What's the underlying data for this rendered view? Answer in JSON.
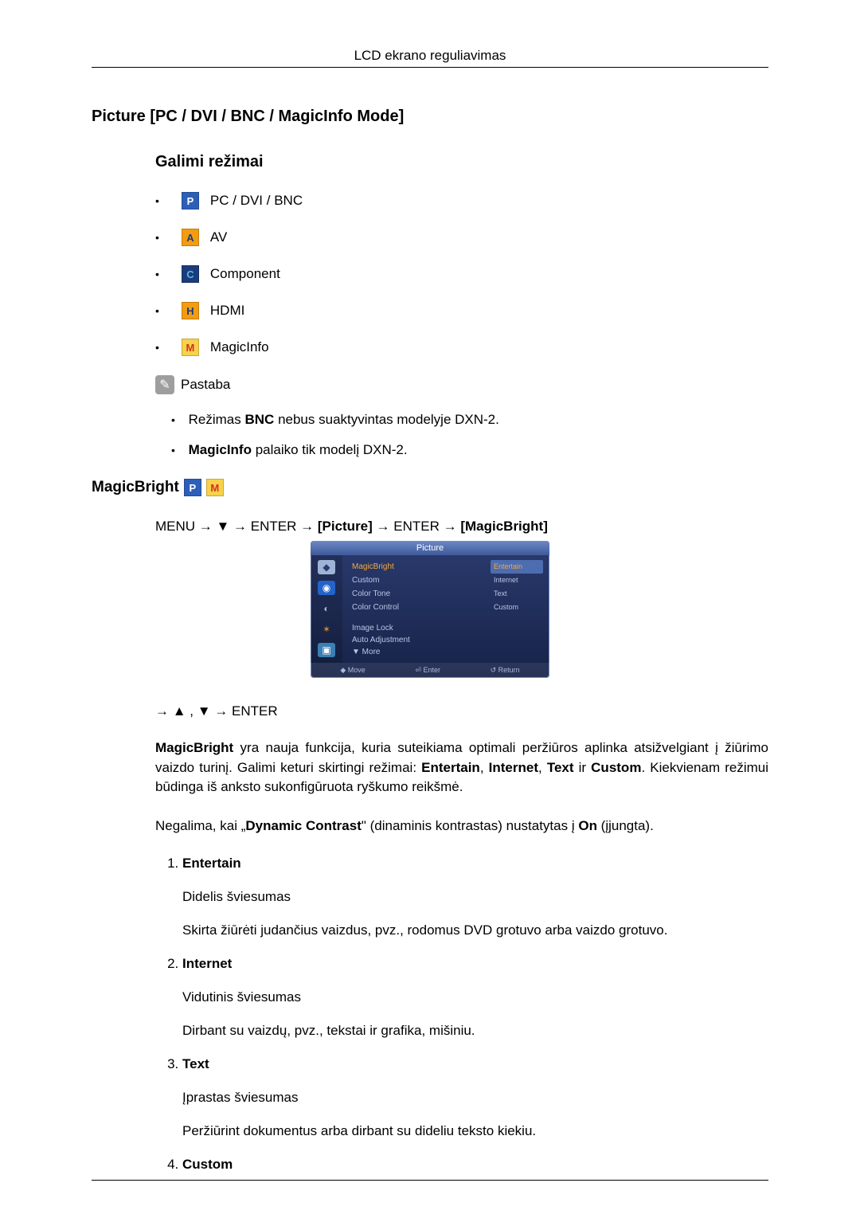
{
  "header": "LCD ekrano reguliavimas",
  "h1": "Picture [PC / DVI / BNC / MagicInfo Mode]",
  "h2_modes": "Galimi režimai",
  "modes": {
    "pc": {
      "icon": "P",
      "label": " PC / DVI / BNC"
    },
    "av": {
      "icon": "A",
      "label": " AV"
    },
    "component": {
      "icon": "C",
      "label": " Component"
    },
    "hdmi": {
      "icon": "H",
      "label": " HDMI"
    },
    "magicinfo": {
      "icon": "M",
      "label": " MagicInfo"
    }
  },
  "note": {
    "title": "Pastaba",
    "item1_a": "Režimas ",
    "item1_b": "BNC",
    "item1_c": " nebus suaktyvintas modelyje DXN-2.",
    "item2_a": "MagicInfo",
    "item2_b": " palaiko tik modelį DXN-2."
  },
  "magicbright": {
    "title": "MagicBright ",
    "path_a": "MENU → ▼ → ENTER → ",
    "path_b": "[Picture]",
    "path_c": " → ENTER → ",
    "path_d": "[MagicBright]",
    "path2": "→ ▲ , ▼ → ENTER",
    "desc_a": "MagicBright",
    "desc_b": " yra nauja funkcija, kuria suteikiama optimali peržiūros aplinka atsižvelgiant į žiūrimo vaizdo turinį. Galimi keturi skirtingi režimai: ",
    "desc_c": "Entertain",
    "desc_d": ", ",
    "desc_e": "Internet",
    "desc_f": ", ",
    "desc_g": "Text",
    "desc_h": " ir ",
    "desc_i": "Custom",
    "desc_j": ". Kiekvienam režimui būdinga iš anksto sukonfigūruota ryškumo reikšmė.",
    "dyn_a": "Negalima, kai „",
    "dyn_b": "Dynamic Contrast",
    "dyn_c": "\" (dinaminis kontrastas) nustatytas į ",
    "dyn_d": "On",
    "dyn_e": " (įjungta).",
    "items": {
      "entertain": {
        "title": "Entertain",
        "p1": "Didelis šviesumas",
        "p2": "Skirta žiūrėti judančius vaizdus, pvz., rodomus DVD grotuvo arba vaizdo grotuvo."
      },
      "internet": {
        "title": "Internet",
        "p1": "Vidutinis šviesumas",
        "p2": "Dirbant su vaizdų, pvz., tekstai ir grafika, mišiniu."
      },
      "text": {
        "title": "Text",
        "p1": "Įprastas šviesumas",
        "p2": "Peržiūrint dokumentus arba dirbant su dideliu teksto kiekiu."
      },
      "custom": {
        "title": "Custom"
      }
    }
  },
  "osd": {
    "title": "Picture",
    "menu": {
      "magicbright": "MagicBright",
      "custom": "Custom",
      "colortone": "Color Tone",
      "colorcontrol": "Color Control",
      "imagelock": "Image Lock",
      "autoadj": "Auto Adjustment",
      "more": "▼ More"
    },
    "values": {
      "entertain": "Entertain",
      "internet": "Internet",
      "text": "Text",
      "custom": "Custom"
    },
    "footer": {
      "move": "Move",
      "enter": "Enter",
      "return": "Return"
    }
  }
}
